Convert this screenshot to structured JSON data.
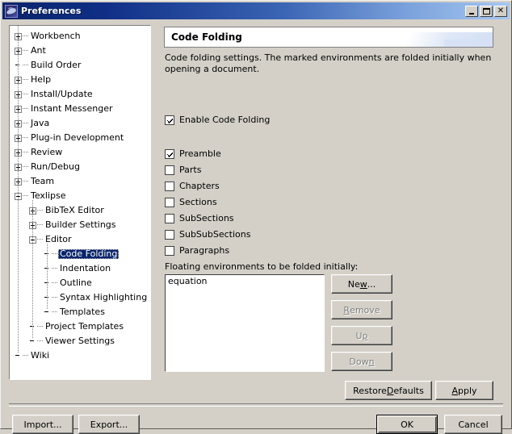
{
  "window": {
    "title": "Preferences",
    "icon": "eclipse-preferences-icon",
    "controls": {
      "minimize": "Minimize",
      "maximize": "Maximize",
      "close": "Close"
    }
  },
  "tree": {
    "items": [
      {
        "label": "Workbench",
        "depth": 0,
        "toggle": "plus",
        "selected": false
      },
      {
        "label": "Ant",
        "depth": 0,
        "toggle": "plus",
        "selected": false
      },
      {
        "label": "Build Order",
        "depth": 0,
        "toggle": "none",
        "selected": false
      },
      {
        "label": "Help",
        "depth": 0,
        "toggle": "plus",
        "selected": false
      },
      {
        "label": "Install/Update",
        "depth": 0,
        "toggle": "plus",
        "selected": false
      },
      {
        "label": "Instant Messenger",
        "depth": 0,
        "toggle": "plus",
        "selected": false
      },
      {
        "label": "Java",
        "depth": 0,
        "toggle": "plus",
        "selected": false
      },
      {
        "label": "Plug-in Development",
        "depth": 0,
        "toggle": "plus",
        "selected": false
      },
      {
        "label": "Review",
        "depth": 0,
        "toggle": "plus",
        "selected": false
      },
      {
        "label": "Run/Debug",
        "depth": 0,
        "toggle": "plus",
        "selected": false
      },
      {
        "label": "Team",
        "depth": 0,
        "toggle": "plus",
        "selected": false
      },
      {
        "label": "Texlipse",
        "depth": 0,
        "toggle": "minus",
        "selected": false
      },
      {
        "label": "BibTeX Editor",
        "depth": 1,
        "toggle": "plus",
        "selected": false
      },
      {
        "label": "Builder Settings",
        "depth": 1,
        "toggle": "plus",
        "selected": false
      },
      {
        "label": "Editor",
        "depth": 1,
        "toggle": "minus",
        "selected": false
      },
      {
        "label": "Code Folding",
        "depth": 2,
        "toggle": "none",
        "selected": true
      },
      {
        "label": "Indentation",
        "depth": 2,
        "toggle": "none",
        "selected": false
      },
      {
        "label": "Outline",
        "depth": 2,
        "toggle": "none",
        "selected": false
      },
      {
        "label": "Syntax Highlighting",
        "depth": 2,
        "toggle": "none",
        "selected": false
      },
      {
        "label": "Templates",
        "depth": 2,
        "toggle": "none",
        "selected": false
      },
      {
        "label": "Project Templates",
        "depth": 1,
        "toggle": "none",
        "selected": false
      },
      {
        "label": "Viewer Settings",
        "depth": 1,
        "toggle": "none",
        "selected": false
      },
      {
        "label": "Wiki",
        "depth": 0,
        "toggle": "none",
        "selected": false
      }
    ]
  },
  "pane": {
    "banner_title": "Code Folding",
    "description": "Code folding settings. The marked environments are folded initially when opening a document.",
    "enable": {
      "label": "Enable Code Folding",
      "checked": true
    },
    "environments": [
      {
        "label": "Preamble",
        "checked": true
      },
      {
        "label": "Parts",
        "checked": false
      },
      {
        "label": "Chapters",
        "checked": false
      },
      {
        "label": "Sections",
        "checked": false
      },
      {
        "label": "SubSections",
        "checked": false
      },
      {
        "label": "SubSubSections",
        "checked": false
      },
      {
        "label": "Paragraphs",
        "checked": false
      }
    ],
    "floating_label": "Floating environments to be folded initially:",
    "listbox": {
      "items": [
        "equation"
      ]
    },
    "side_buttons": [
      {
        "label": "New...",
        "mnemonic": "w",
        "enabled": true
      },
      {
        "label": "Remove",
        "mnemonic": "R",
        "enabled": false
      },
      {
        "label": "Up",
        "mnemonic": "p",
        "enabled": false
      },
      {
        "label": "Down",
        "mnemonic": "n",
        "enabled": false
      }
    ],
    "restore_defaults": {
      "label": "Restore Defaults",
      "mnemonic": "D"
    },
    "apply": {
      "label": "Apply",
      "mnemonic": "A"
    }
  },
  "footer": {
    "import": "Import...",
    "export": "Export...",
    "ok": "OK",
    "cancel": "Cancel"
  },
  "colors": {
    "face": "#d4d0c8",
    "title_start": "#0a246a",
    "title_end": "#a6c8f0",
    "selection": "#08246b",
    "disabled_text": "#808080"
  }
}
